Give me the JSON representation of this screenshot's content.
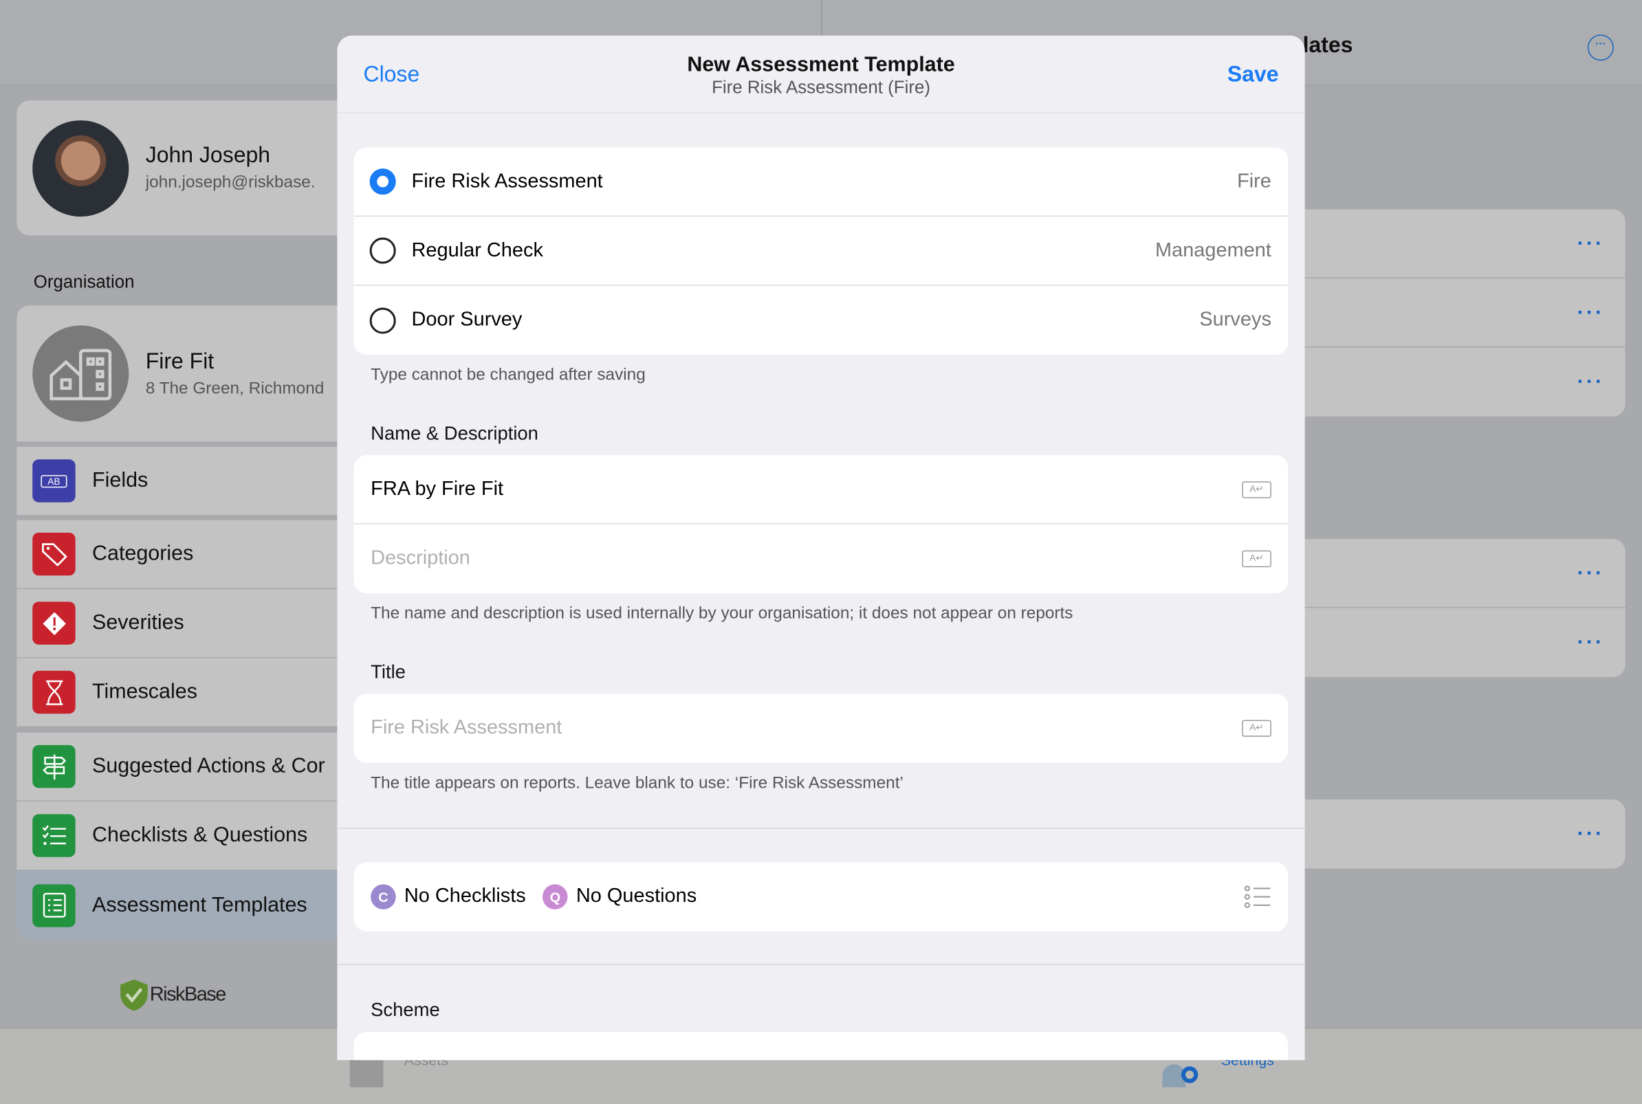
{
  "background": {
    "title_fragment": "lates",
    "profile": {
      "name": "John Joseph",
      "email": "john.joseph@riskbase."
    },
    "organisation_header": "Organisation",
    "organisation": {
      "name": "Fire Fit",
      "address": "8 The Green, Richmond"
    },
    "sidebar": {
      "items": [
        {
          "label": "Fields",
          "icon": "text-field-icon",
          "color": "#3d3fa8"
        },
        {
          "label": "Categories",
          "icon": "tag-icon",
          "color": "#c8232c"
        },
        {
          "label": "Severities",
          "icon": "warning-diamond-icon",
          "color": "#c8232c"
        },
        {
          "label": "Timescales",
          "icon": "hourglass-icon",
          "color": "#c8232c"
        },
        {
          "label": "Suggested Actions & Cor",
          "icon": "signpost-icon",
          "color": "#22943f"
        },
        {
          "label": "Checklists & Questions",
          "icon": "checklist-icon",
          "color": "#22943f"
        },
        {
          "label": "Assessment Templates",
          "icon": "template-icon",
          "color": "#22943f",
          "selected": true
        }
      ]
    },
    "brand": "RiskBase",
    "tabbar": {
      "assets": "Assets",
      "settings": "Settings"
    }
  },
  "modal": {
    "close_label": "Close",
    "save_label": "Save",
    "title": "New Assessment Template",
    "subtitle": "Fire Risk Assessment (Fire)",
    "types": [
      {
        "label": "Fire Risk Assessment",
        "value": "Fire",
        "selected": true
      },
      {
        "label": "Regular Check",
        "value": "Management",
        "selected": false
      },
      {
        "label": "Door Survey",
        "value": "Surveys",
        "selected": false
      }
    ],
    "type_footer": "Type cannot be changed after saving",
    "name_header": "Name & Description",
    "name_value": "FRA by Fire Fit",
    "description_placeholder": "Description",
    "name_footer": "The name and description is used internally by your organisation; it does not appear on reports",
    "title_header": "Title",
    "title_placeholder": "Fire Risk Assessment",
    "title_footer": "The title appears on reports. Leave blank to use: ‘Fire Risk Assessment’",
    "checklists_label": "No Checklists",
    "checklists_badge": "C",
    "questions_label": "No Questions",
    "questions_badge": "Q",
    "scheme_header": "Scheme",
    "accent": "#1a7cf5"
  }
}
